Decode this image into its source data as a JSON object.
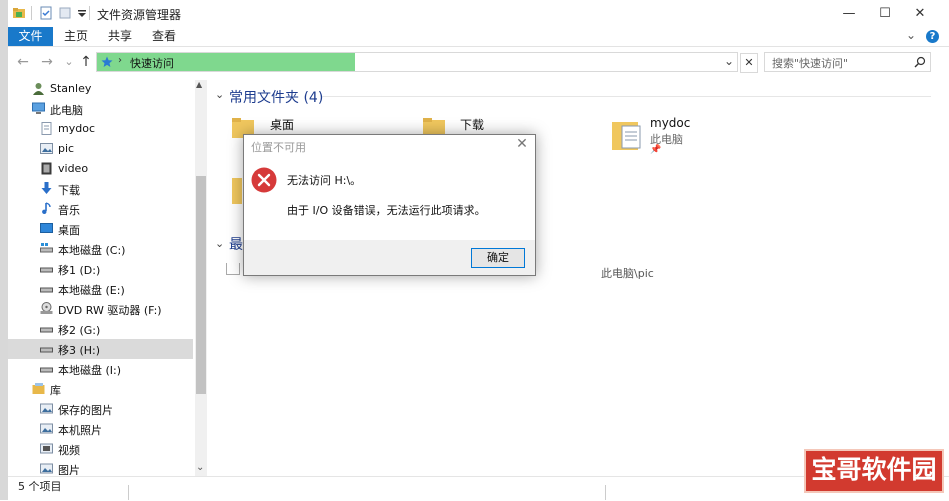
{
  "window": {
    "title": "文件资源管理器",
    "controls": {
      "minimize": "—",
      "maximize": "☐",
      "close": "✕"
    }
  },
  "ribbon": {
    "tabs": [
      {
        "label": "文件"
      },
      {
        "label": "主页"
      },
      {
        "label": "共享"
      },
      {
        "label": "查看"
      }
    ],
    "collapse": "⌄",
    "help": "?"
  },
  "address": {
    "back": "←",
    "forward": "→",
    "recent": "⌄",
    "up": "↑",
    "path": "快速访问",
    "dropdown": "⌄",
    "clear": "✕"
  },
  "search": {
    "placeholder": "搜索\"快速访问\""
  },
  "nav": {
    "items": [
      {
        "label": "Stanley",
        "icon": "user-icon"
      },
      {
        "label": "此电脑",
        "icon": "computer-icon"
      },
      {
        "label": "mydoc",
        "icon": "doc-folder-icon"
      },
      {
        "label": "pic",
        "icon": "picture-folder-icon"
      },
      {
        "label": "video",
        "icon": "video-folder-icon"
      },
      {
        "label": "下载",
        "icon": "download-icon"
      },
      {
        "label": "音乐",
        "icon": "music-icon"
      },
      {
        "label": "桌面",
        "icon": "desktop-icon"
      },
      {
        "label": "本地磁盘 (C:)",
        "icon": "system-drive-icon"
      },
      {
        "label": "移1 (D:)",
        "icon": "drive-icon"
      },
      {
        "label": "本地磁盘 (E:)",
        "icon": "drive-icon"
      },
      {
        "label": "DVD RW 驱动器 (F:)",
        "icon": "dvd-drive-icon"
      },
      {
        "label": "移2 (G:)",
        "icon": "drive-icon"
      },
      {
        "label": "移3 (H:)",
        "icon": "drive-icon"
      },
      {
        "label": "本地磁盘 (I:)",
        "icon": "drive-icon"
      },
      {
        "label": "库",
        "icon": "library-icon"
      },
      {
        "label": "保存的图片",
        "icon": "picture-library-icon"
      },
      {
        "label": "本机照片",
        "icon": "picture-library-icon"
      },
      {
        "label": "视频",
        "icon": "video-library-icon"
      },
      {
        "label": "图片",
        "icon": "picture-library-icon"
      }
    ],
    "selected": "移3 (H:)"
  },
  "content": {
    "frequent_header": "常用文件夹 (4)",
    "folders": [
      {
        "name": "桌面"
      },
      {
        "name": "下载"
      },
      {
        "name": "mydoc",
        "sub": "此电脑",
        "pin": "📌"
      }
    ],
    "recent_header": "最",
    "recent_path": "此电脑\\pic"
  },
  "status": {
    "text": "5 个项目"
  },
  "dialog": {
    "title": "位置不可用",
    "message": "无法访问 H:\\。",
    "detail": "由于 I/O 设备错误，无法运行此项请求。",
    "ok": "确定",
    "close": "✕"
  },
  "watermark": {
    "text": "宝哥软件园"
  },
  "colors": {
    "accent": "#1979ca",
    "address_fill": "#7fd88e",
    "error": "#d63a3a",
    "folder": "#f0c75e",
    "group_header": "#1e3d8f",
    "watermark": "#d23a2f"
  }
}
